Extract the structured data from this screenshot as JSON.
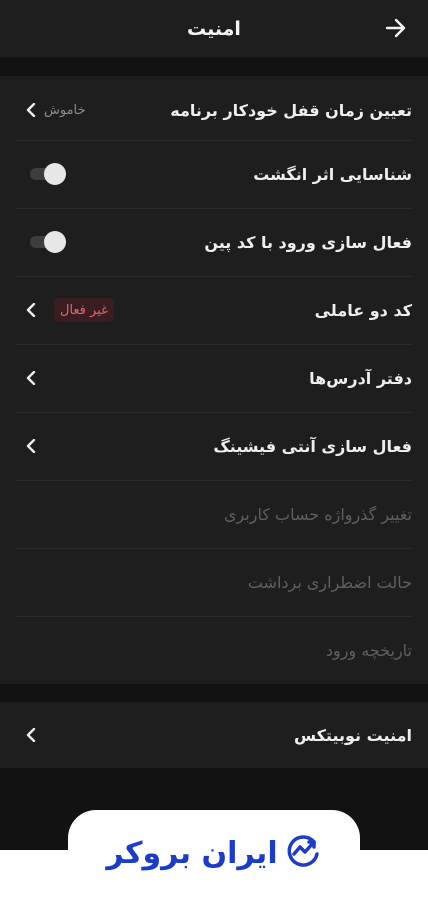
{
  "header": {
    "title": "امنیت"
  },
  "security_items": [
    {
      "label": "تعیین زمان قفل خودکار برنامه",
      "value": "خاموش"
    },
    {
      "label": "شناسایی اثر انگشت"
    },
    {
      "label": "فعال سازی ورود با کد پین"
    },
    {
      "label": "کد دو عاملی",
      "badge": "غیر فعال"
    },
    {
      "label": "دفتر آدرس‌ها"
    },
    {
      "label": "فعال سازی آنتی فیشینگ"
    },
    {
      "label": "تغییر گذرواژه حساب کاربری"
    },
    {
      "label": "حالت اضطراری برداشت"
    },
    {
      "label": "تاریخچه ورود"
    }
  ],
  "nobitex_section": {
    "label": "امنیت نوبیتکس"
  },
  "watermark": {
    "text": "ایران بروکر"
  },
  "colors": {
    "background": "#121212",
    "surface": "#1e1e1e",
    "badge_text": "#e0646e",
    "badge_bg": "#3a1d20",
    "logo_blue": "#1b3cc8"
  },
  "icons": {
    "back": "arrow-right-icon",
    "chevron": "chevron-left-icon",
    "logo": "chart-check-logo-icon"
  }
}
